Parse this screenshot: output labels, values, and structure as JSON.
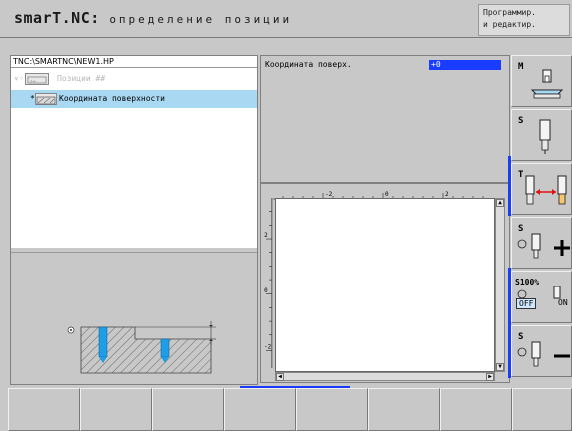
{
  "header": {
    "app_name": "smarT.NC:",
    "screen_title": "определение позиции",
    "mode_line1": "Программир.",
    "mode_line2": "и редактир."
  },
  "tree": {
    "path": "TNC:\\SMARTNC\\NEW1.HP",
    "items": [
      {
        "label": "Позиции",
        "suffix": "##",
        "state": "dimmed"
      },
      {
        "label": "Координата поверхности",
        "state": "selected"
      }
    ]
  },
  "form": {
    "field_label": "Координата поверх.",
    "field_value": "+0"
  },
  "graphic": {
    "top_ruler_labels": [
      "-2",
      "0",
      "2"
    ],
    "left_ruler_labels": [
      "2",
      "0",
      "-2"
    ]
  },
  "softkeys_right": [
    {
      "name": "M",
      "icon": "machine-table-icon"
    },
    {
      "name": "S",
      "icon": "spindle-icon"
    },
    {
      "name": "T",
      "icon": "tool-change-icon"
    },
    {
      "name": "S",
      "icon": "spindle-plus-icon",
      "glyph": "+"
    },
    {
      "name": "S100%",
      "icon": "spindle-override-icon",
      "off_label": "OFF",
      "on_label": "ON"
    },
    {
      "name": "S",
      "icon": "spindle-minus-icon",
      "glyph": "–"
    }
  ],
  "colors": {
    "selection": "#a9d8f2",
    "input_bg": "#1a3cff",
    "panel": "#c8c8c8",
    "accent": "#1a3cff",
    "tool_blue": "#1e9ee6"
  }
}
